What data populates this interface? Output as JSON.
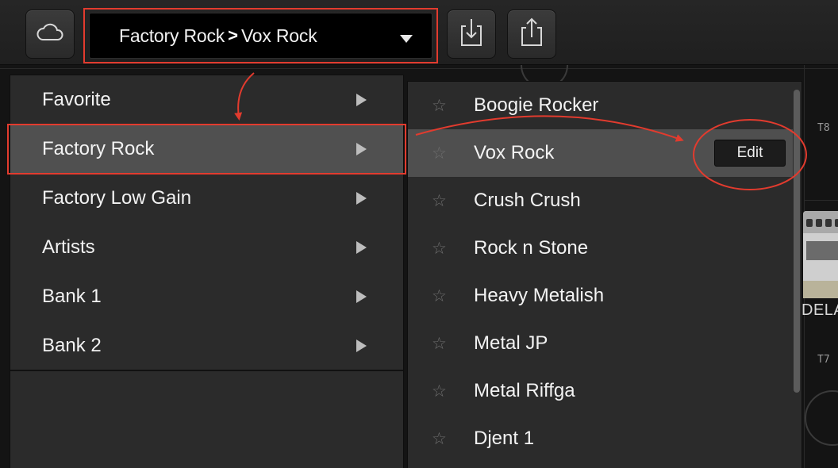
{
  "toolbar": {
    "cloud_icon": "cloud-icon",
    "breadcrumb": {
      "parent": "Factory Rock",
      "separator": ">",
      "current": "Vox Rock"
    },
    "download_icon": "download-icon",
    "upload_icon": "upload-icon"
  },
  "background": {
    "labels": {
      "t8": "T8",
      "t7": "T7"
    },
    "pedal_name": "DELA"
  },
  "bank_menu": {
    "items": [
      {
        "label": "Favorite"
      },
      {
        "label": "Factory Rock",
        "selected": true
      },
      {
        "label": "Factory Low Gain"
      },
      {
        "label": "Artists"
      },
      {
        "label": "Bank 1"
      },
      {
        "label": "Bank 2"
      }
    ]
  },
  "preset_menu": {
    "items": [
      {
        "label": "Boogie Rocker"
      },
      {
        "label": "Vox Rock",
        "selected": true
      },
      {
        "label": "Crush Crush"
      },
      {
        "label": "Rock n Stone"
      },
      {
        "label": "Heavy Metalish"
      },
      {
        "label": "Metal JP"
      },
      {
        "label": "Metal Riffga"
      },
      {
        "label": "Djent 1"
      }
    ],
    "edit_label": "Edit"
  },
  "colors": {
    "annotation": "#e23b2e",
    "selected_row": "#505050",
    "menu_bg": "#2b2b2b"
  }
}
